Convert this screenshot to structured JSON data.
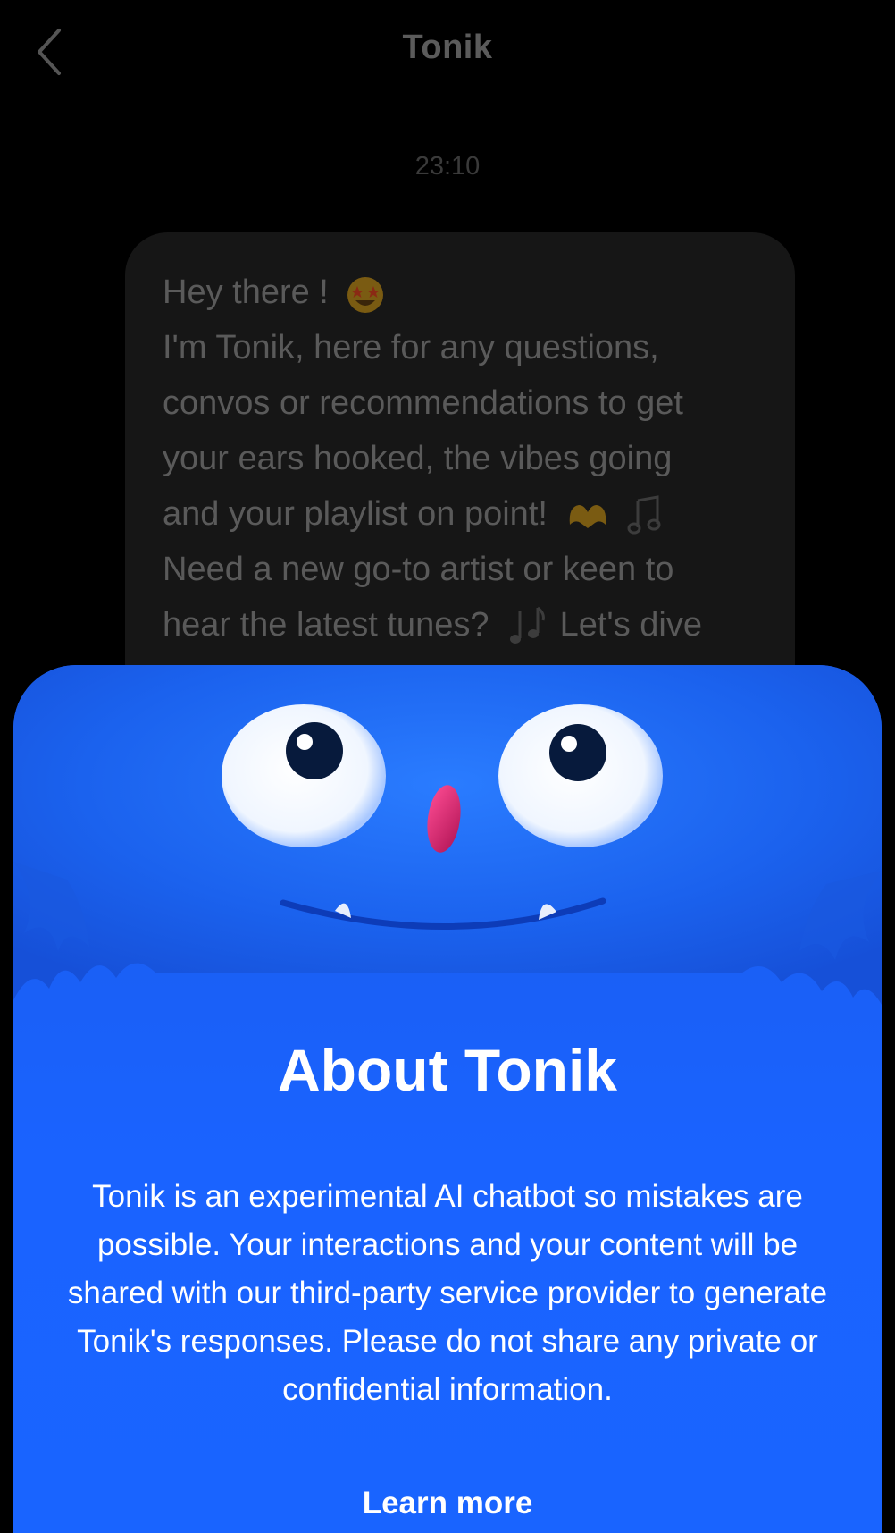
{
  "header": {
    "title": "Tonik"
  },
  "chat": {
    "timestamp": "23:10",
    "message_lines": [
      "Hey there !",
      "I'm Tonik, here for any questions,",
      "convos or recommendations to get",
      "your ears hooked, the vibes going",
      "and your playlist on point!",
      "Need a new go-to artist or keen to",
      "hear the latest tunes?",
      "Let's dive"
    ]
  },
  "sheet": {
    "title": "About Tonik",
    "body": "Tonik is an experimental AI chatbot so mistakes are possible. Your interactions and your content will be shared with our third-party service provider to generate Tonik's responses. Please do not share any private or confidential information.",
    "learn_more_label": "Learn more"
  },
  "colors": {
    "background": "#000000",
    "sheet_blue": "#1a63ff",
    "bubble": "#161616",
    "dim_text": "#5a5a5a"
  },
  "icons": {
    "back": "chevron-left-icon",
    "emoji_1": "star-struck-emoji",
    "emoji_2": "heart-hands-emoji",
    "emoji_3": "music-note-emoji",
    "emoji_4": "music-notes-emoji"
  }
}
